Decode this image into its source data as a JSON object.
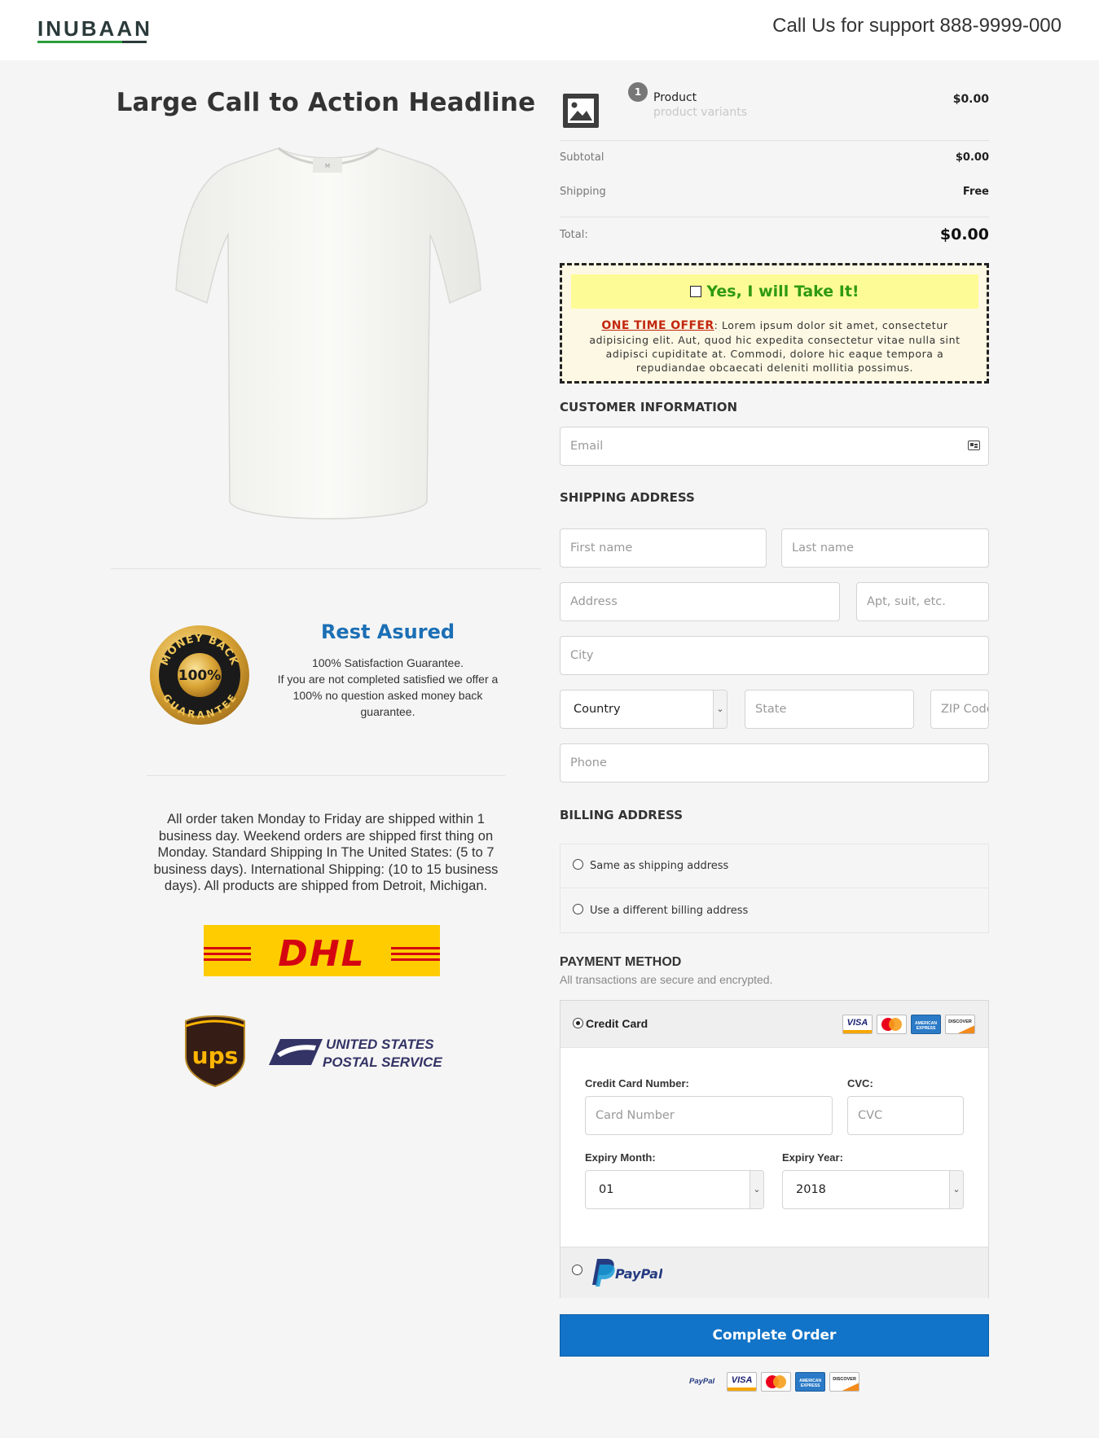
{
  "header": {
    "logo_text": "INUBAAN",
    "support": "Call Us for support 888-9999-000"
  },
  "left": {
    "headline": "Large Call to Action Headline",
    "seal_text": {
      "top": "MONEY BACK",
      "mid": "100%",
      "bottom": "GUARANTEE"
    },
    "guarantee_title": "Rest Asured",
    "guarantee_lines": [
      "100% Satisfaction Guarantee.",
      "If you are not completed satisfied we offer a",
      "100%  no question asked money back",
      "guarantee."
    ],
    "shipping_lines": [
      "All order taken Monday to Friday are shipped within 1",
      "business day. Weekend orders are shipped first thing on",
      "Monday. Standard Shipping In The United States: (5 to 7",
      "business days). International Shipping: (10 to 15 business",
      "days). All products are shipped from Detroit, Michigan."
    ],
    "carrier_dhl": "DHL",
    "carrier_ups": "ups",
    "carrier_usps": [
      "UNITED STATES",
      "POSTAL SERVICE"
    ]
  },
  "order": {
    "qty": "1",
    "product_name": "Product",
    "product_variants": "product variants",
    "product_price": "$0.00",
    "subtotal_label": "Subtotal",
    "subtotal": "$0.00",
    "shipping_label": "Shipping",
    "shipping": "Free",
    "total_label": "Total:",
    "total": "$0.00"
  },
  "offer": {
    "yes_label": "Yes, I will Take It!",
    "head": "ONE TIME OFFER",
    "body_lines": [
      ": Lorem ipsum dolor sit amet, consectetur",
      "adipisicing elit. Aut, quod hic expedita consectetur vitae nulla sint",
      "adipisci cupiditate at. Commodi, dolore hic eaque tempora a",
      "repudiandae obcaecati deleniti mollitia possimus."
    ]
  },
  "customer": {
    "title": "CUSTOMER INFORMATION",
    "email_placeholder": "Email"
  },
  "shipping": {
    "title": "SHIPPING ADDRESS",
    "first_name": "First name",
    "last_name": "Last name",
    "address": "Address",
    "apt": "Apt, suit, etc.",
    "city": "City",
    "country": "Country",
    "state": "State",
    "zip": "ZIP Code",
    "phone": "Phone"
  },
  "billing": {
    "title": "BILLING ADDRESS",
    "same": "Same as shipping address",
    "different": "Use a different billing address"
  },
  "payment": {
    "title": "PAYMENT METHOD",
    "subtitle": "All transactions are secure and encrypted.",
    "credit_card": "Credit Card",
    "card_number_label": "Credit Card Number:",
    "card_number_placeholder": "Card Number",
    "cvc_label": "CVC:",
    "cvc_placeholder": "CVC",
    "expiry_month_label": "Expiry Month:",
    "expiry_month": "01",
    "expiry_year_label": "Expiry Year:",
    "expiry_year": "2018",
    "paypal": "PayPal",
    "card_brands": [
      "VISA",
      "MasterCard",
      "AMERICAN EXPRESS",
      "DISCOVER"
    ]
  },
  "complete_button": "Complete Order",
  "colors": {
    "accent_blue": "#1274c8",
    "offer_green": "#2f9a12",
    "offer_red": "#c2270f",
    "offer_yellow": "#fdfb95",
    "title_blue": "#1b6fb5"
  }
}
